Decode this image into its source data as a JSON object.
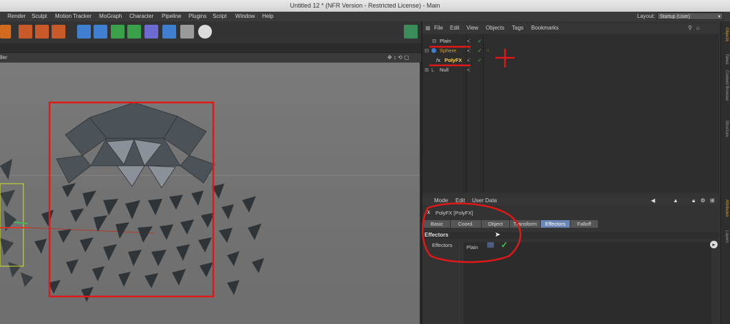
{
  "window": {
    "title": "Untitled 12 * (NFR Version - Restricted License) - Main"
  },
  "menubar": {
    "items": [
      "Render",
      "Sculpt",
      "Motion Tracker",
      "MoGraph",
      "Character",
      "Pipeline",
      "Plugins",
      "Script",
      "Window",
      "Help"
    ],
    "layout_label": "Layout:",
    "layout_value": "Startup (User)"
  },
  "viewport": {
    "header_label": "ller"
  },
  "object_manager": {
    "menu": [
      "File",
      "Edit",
      "View",
      "Objects",
      "Tags",
      "Bookmarks"
    ],
    "objects": [
      {
        "name": "Plain",
        "color": "#d9d9d9"
      },
      {
        "name": "Sphere",
        "color": "#e0a020"
      },
      {
        "name": "PolyFX",
        "color": "#ffd24a"
      },
      {
        "name": "Null",
        "color": "#d9d9d9"
      }
    ]
  },
  "attributes": {
    "menu": [
      "Mode",
      "Edit",
      "User Data"
    ],
    "object_title": "PolyFX [PolyFX]",
    "tabs": [
      "Basic",
      "Coord.",
      "Object",
      "Transform",
      "Effectors",
      "Falloff"
    ],
    "active_tab": "Effectors",
    "section_title": "Effectors",
    "field_label": "Effectors",
    "field_value": "Plain"
  },
  "side_tabs": [
    "Objects",
    "Takes",
    "Content Browser",
    "Structure",
    "Attributes",
    "Layers"
  ],
  "colors": {
    "annotation_red": "#e01818",
    "active_tab": "#6a86b6",
    "check_green": "#44cc44"
  }
}
